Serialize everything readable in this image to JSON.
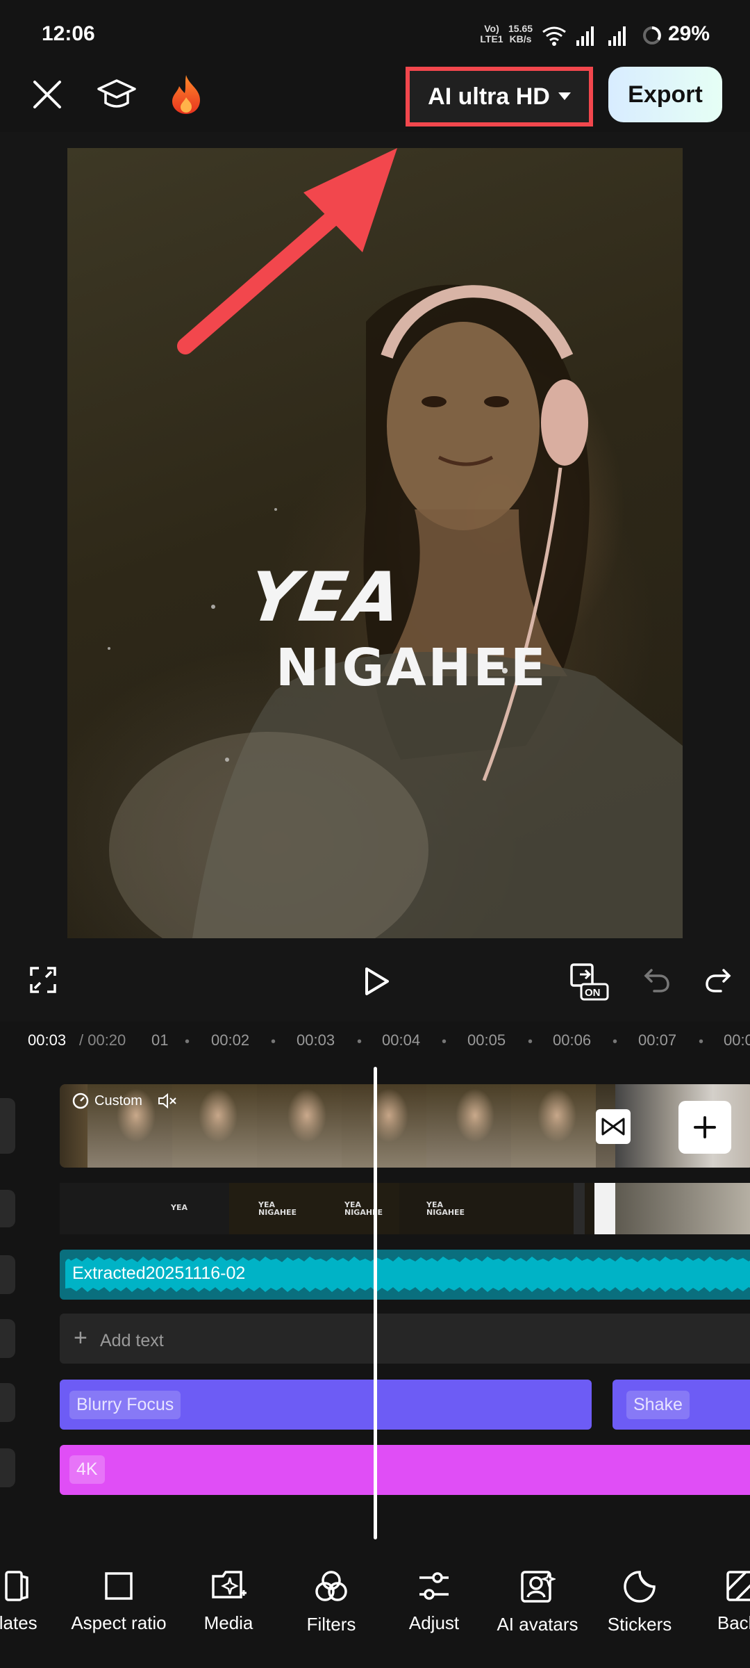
{
  "status": {
    "time": "12:06",
    "network": "Vo) LTE1",
    "speed_value": "15.65",
    "speed_unit": "KB/s",
    "battery": "29%"
  },
  "toolbar": {
    "quality_label": "AI ultra HD",
    "export_label": "Export"
  },
  "preview": {
    "lyric_line1": "YEA",
    "lyric_line2": "NIGAHEE"
  },
  "controls": {
    "preview_toggle_badge": "ON"
  },
  "timeline": {
    "current_time": "00:03",
    "total_time": "/ 00:20",
    "ticks": [
      "01",
      "00:02",
      "00:03",
      "00:04",
      "00:05",
      "00:06",
      "00:07",
      "00:0"
    ],
    "video_clip_speed_label": "Custom",
    "audio_track_label": "Extracted20251116-02",
    "add_text_label": "Add text",
    "effect_1": "Blurry Focus",
    "effect_2": "Shake",
    "filter_label": "4K",
    "overlay_snippets": [
      "YEA",
      "YEA NIGAHEE",
      "YEA NIGAHEE",
      "YEA NIGAHEE"
    ]
  },
  "bottom_tools": [
    {
      "label": "plates",
      "icon": "templates-icon"
    },
    {
      "label": "Aspect ratio",
      "icon": "aspect-ratio-icon"
    },
    {
      "label": "Media",
      "icon": "media-icon"
    },
    {
      "label": "Filters",
      "icon": "filters-icon"
    },
    {
      "label": "Adjust",
      "icon": "adjust-icon"
    },
    {
      "label": "AI avatars",
      "icon": "ai-avatars-icon"
    },
    {
      "label": "Stickers",
      "icon": "stickers-icon"
    },
    {
      "label": "Backg",
      "icon": "background-icon"
    }
  ],
  "colors": {
    "highlight_border": "#f2474d",
    "annotation_arrow": "#f2474d",
    "audio_track": "#00b3c6",
    "effect_track": "#6d5cf5",
    "filter_track": "#e04ef6"
  }
}
